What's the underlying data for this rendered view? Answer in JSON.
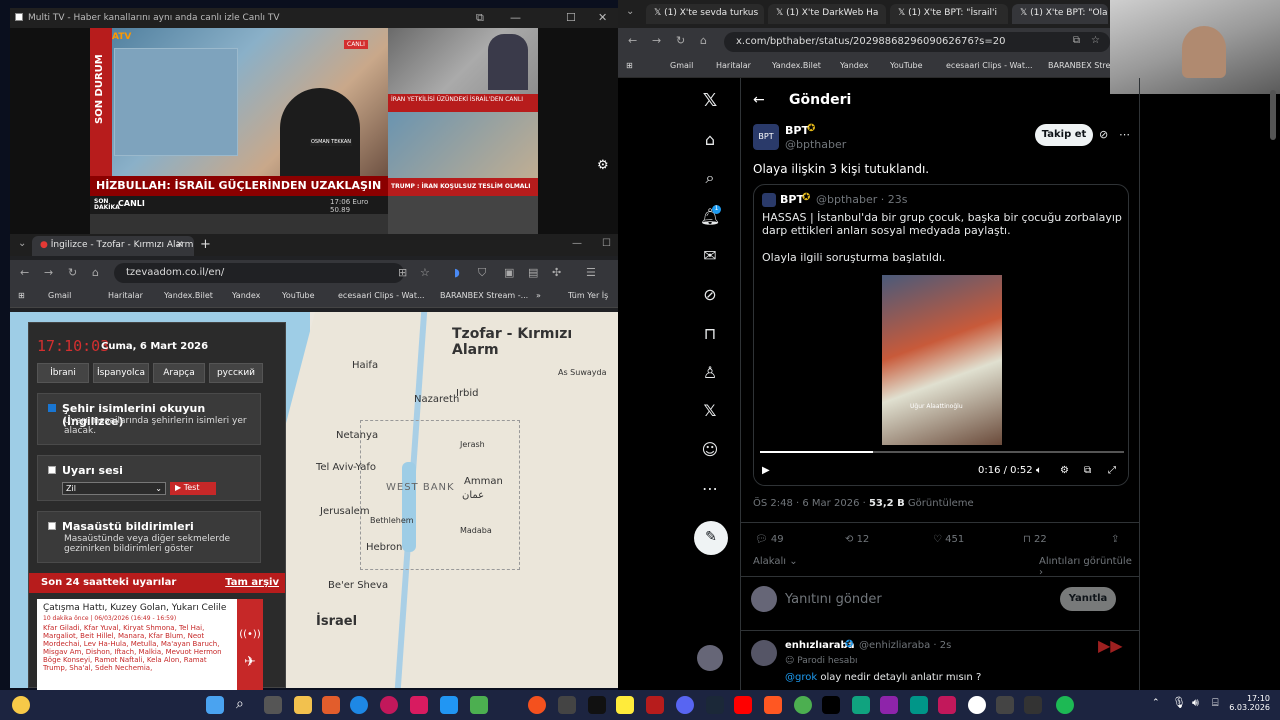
{
  "tv": {
    "window_title": "Multi TV - Haber kanallarını aynı anda canlı izle Canlı TV",
    "side_label": "SON DURUM",
    "banner": "HİZBULLAH: İSRAİL GÜÇLERİNDEN UZAKLAŞIN",
    "ticker_left": "SON DAKİKA",
    "ticker_live": "CANLI",
    "ticker_right": "17:06 Euro 50.89",
    "logo": "ATV",
    "live_tag": "CANLI",
    "news2": "İRAN YETKİLİSİ ÜZÜNDEKİ İSRAİL'DEN CANLI",
    "news3": "TRUMP : İRAN KOŞULSUZ TESLİM OLMALI",
    "anchor_caption": "OSMAN TEKKAN"
  },
  "tzofar": {
    "tab_title": "İngilizce - Tzofar - Kırmızı Alarm",
    "url": "tzevaadom.co.il/en/",
    "bookmarks": [
      "Gmail",
      "Haritalar",
      "Yandex.Bilet",
      "Yandex",
      "YouTube",
      "ecesaari Clips - Wat...",
      "BARANBEX Stream -..."
    ],
    "bookmarks_more": "»",
    "all_bookmarks": "Tüm Yer İş",
    "map_title": "Tzofar - Kırmızı Alarm",
    "clock": "17:10:03",
    "date": "Cuma, 6 Mart 2026",
    "languages": [
      "İbrani",
      "İspanyolca",
      "Arapça",
      "русский"
    ],
    "read_names_title": "Şehir isimlerini okuyun (İngilizce)",
    "read_names_desc": "Uyarı mesajlarında şehirlerin isimleri yer alacak.",
    "sound_title": "Uyarı sesi",
    "sound_option": "Zil",
    "test_label": "▶ Test",
    "desktop_title": "Masaüstü bildirimleri",
    "desktop_desc": "Masaüstünde veya diğer sekmelerde gezinirken bildirimleri göster",
    "alerts_title": "Son 24 saatteki uyarılar",
    "alerts_archive": "Tam arşiv",
    "alert_name": "Çatışma Hattı, Kuzey Golan, Yukarı Celile",
    "alert_time": "10 dakika önce | 06/03/2026 (16:49 - 16:59)",
    "alert_list": "Kfar Giladi, Kfar Yuval, Kiryat Shmona, Tel Hai, Margaliot, Beit Hillel, Manara, Kfar Blum, Neot Mordechai, Lev Ha-Hula, Metulla, Ma'ayan Baruch, Misgav Am, Dishon, Iftach, Malkia, Mevuot Hermon Böge Konseyi, Ramot Naftali, Kela Alon, Ramat Trump, Sha'al, Sdeh Nechemia,",
    "map_places": {
      "haifa": "Haifa",
      "nazareth": "Nazareth",
      "netanya": "Netanya",
      "telaviv": "Tel Aviv-Yafo",
      "westbank": "WEST BANK",
      "amman": "Amman",
      "amman_ar": "عمان",
      "jerusalem": "Jerusalem",
      "bethlehem": "Bethlehem",
      "hebron": "Hebron",
      "beersheva": "Be'er Sheva",
      "israel": "İsrael",
      "irbid": "Irbid",
      "jerash": "Jerash",
      "assuwayda": "As Suwayda",
      "madaba": "Madaba"
    }
  },
  "x": {
    "tabs": [
      "(1) X'te sevda turkus",
      "(1) X'te DarkWeb Ha",
      "(1) X'te BPT: \"İsrail'i",
      "(1) X'te BPT: \"Ola"
    ],
    "url": "x.com/bpthaber/status/2029886829609062676?s=20",
    "bookmarks": [
      "Gmail",
      "Haritalar",
      "Yandex.Bilet",
      "Yandex",
      "YouTube",
      "ecesaari Clips - Wat...",
      "BARANBEX Strea"
    ],
    "page_title": "Gönderi",
    "author": "BPT",
    "handle": "@bpthaber",
    "follow": "Takip et",
    "text": "Olaya ilişkin 3 kişi tutuklandı.",
    "quote_author": "BPT",
    "quote_handle": "@bpthaber · 23s",
    "quote_text1": "HASSAS | İstanbul'da bir grup çocuk, başka bir çocuğu zorbalayıp darp ettikleri anları sosyal medyada paylaştı.",
    "quote_text2": "Olayla ilgili soruşturma başlatıldı.",
    "video_watermark": "Uğur Alaattinoğlu",
    "video_time": "0:16 / 0:52",
    "meta_time": "ÖS 2:48 · 6 Mar 2026 · ",
    "meta_views": "53,2 B",
    "meta_views_label": " Görüntüleme",
    "replies": "49",
    "reposts": "12",
    "likes": "451",
    "bookmarks_count": "22",
    "related": "Alakalı",
    "quotes_link": "Alıntıları görüntüle",
    "reply_placeholder": "Yanıtını gönder",
    "reply_button": "Yanıtla",
    "reply_author": "enhızlıaraba",
    "reply_handle": "@enhizliaraba · 2s",
    "reply_badge": "Parodi hesabı",
    "reply_grok": "@grok",
    "reply_text": " olay nedir detaylı anlatır mısın ?"
  },
  "taskbar": {
    "time": "17:10",
    "date": "6.03.2026"
  }
}
